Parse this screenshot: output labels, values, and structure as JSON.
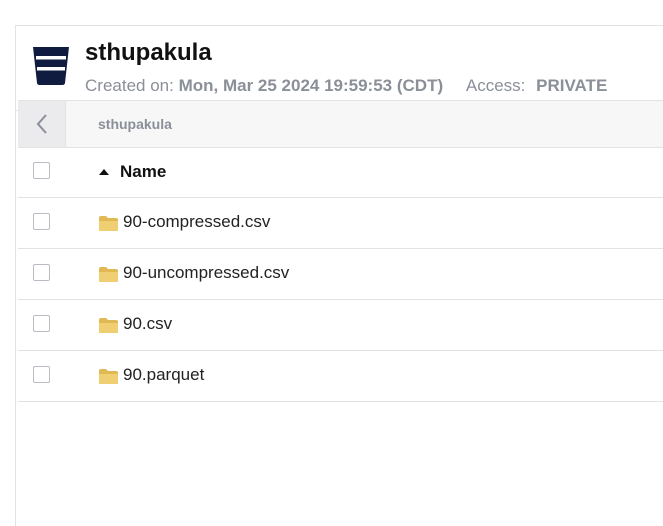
{
  "bucket": {
    "name": "sthupakula",
    "created_label": "Created on:",
    "created_value": "Mon, Mar 25 2024 19:59:53 (CDT)",
    "access_label": "Access:",
    "access_value": "PRIVATE",
    "icon": "bucket-icon"
  },
  "browser": {
    "breadcrumb": "sthupakula",
    "back_icon": "chevron-left-icon",
    "column_header": "Name",
    "sort": "ascending",
    "items": [
      {
        "name": "90-compressed.csv",
        "icon": "folder-icon"
      },
      {
        "name": "90-uncompressed.csv",
        "icon": "folder-icon"
      },
      {
        "name": "90.csv",
        "icon": "folder-icon"
      },
      {
        "name": "90.parquet",
        "icon": "folder-icon"
      }
    ]
  },
  "colors": {
    "folder": "#f0cf73",
    "folder_dark": "#e0b955",
    "bucket_icon": "#0f1c3f",
    "muted_text": "#8a8f98",
    "border": "#e3e3e3"
  }
}
